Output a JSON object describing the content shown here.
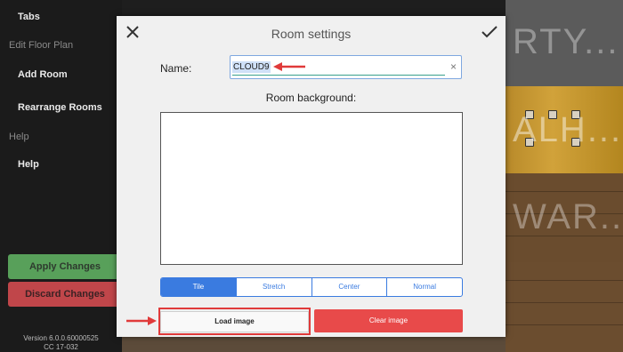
{
  "sidebar": {
    "tabs_label": "Tabs",
    "edit_floor_plan_label": "Edit Floor Plan",
    "add_room_label": "Add Room",
    "rearrange_rooms_label": "Rearrange Rooms",
    "help_section_label": "Help",
    "help_label": "Help",
    "apply_label": "Apply Changes",
    "discard_label": "Discard Changes",
    "version_line1": "Version 6.0.0.60000525",
    "version_line2": "CC 17-032"
  },
  "background": {
    "tile_texts": [
      "RTY...",
      "ALH...",
      "WAR... I"
    ]
  },
  "dialog": {
    "title": "Room settings",
    "close_icon": "close-icon",
    "confirm_icon": "checkmark-icon",
    "name_label": "Name:",
    "name_value": "CLOUD9",
    "clear_glyph": "×",
    "room_background_label": "Room background:",
    "modes": [
      {
        "label": "Tile",
        "active": true
      },
      {
        "label": "Stretch",
        "active": false
      },
      {
        "label": "Center",
        "active": false
      },
      {
        "label": "Normal",
        "active": false
      }
    ],
    "load_image_label": "Load image",
    "clear_image_label": "Clear image"
  },
  "colors": {
    "accent_blue": "#3a7be0",
    "apply_green": "#58a05a",
    "discard_red": "#c0464a",
    "clear_red": "#e84a4a",
    "annotation_red": "#e03a3a"
  }
}
